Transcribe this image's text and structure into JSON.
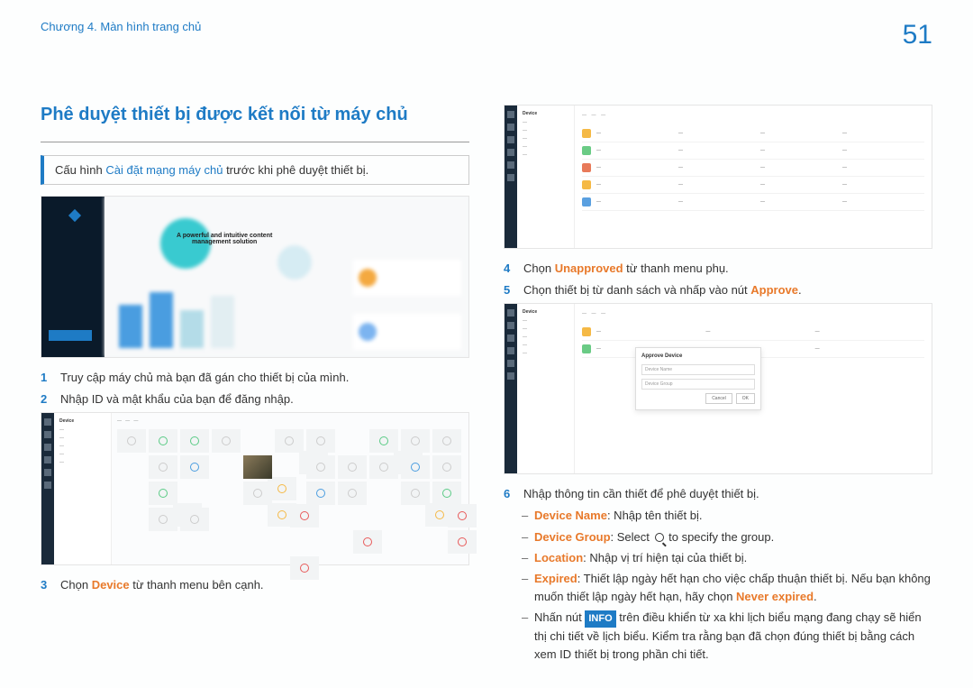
{
  "header": {
    "breadcrumb": "Chương 4. Màn hình trang chủ",
    "page_number": "51"
  },
  "section_title": "Phê duyệt thiết bị được kết nối từ máy chủ",
  "note": {
    "prefix": "Cấu hình ",
    "link": "Cài đặt mạng máy chủ",
    "suffix": " trước khi phê duyệt thiết bị."
  },
  "dash_text1": "A powerful and intuitive content",
  "dash_text2": "management solution",
  "grid_label": "Device",
  "list_label": "Device",
  "dialog_title": "Approve Device",
  "dialog_field1": "Device Name",
  "dialog_field2": "Device Group",
  "dialog_btn1": "Cancel",
  "dialog_btn2": "OK",
  "step1": "Truy cập máy chủ mà bạn đã gán cho thiết bị của mình.",
  "step2": "Nhập ID và mật khẩu của bạn để đăng nhập.",
  "step3_a": "Chọn ",
  "step3_b": "Device",
  "step3_c": " từ thanh menu bên cạnh.",
  "step4_a": "Chọn ",
  "step4_b": "Unapproved",
  "step4_c": " từ thanh menu phụ.",
  "step5_a": "Chọn thiết bị từ danh sách và nhấp vào nút ",
  "step5_b": "Approve",
  "step5_c": ".",
  "step6": "Nhập thông tin cần thiết để phê duyệt thiết bị.",
  "sub1_a": "Device Name",
  "sub1_b": ": Nhập tên thiết bị.",
  "sub2_a": "Device Group",
  "sub2_b": ": Select ",
  "sub2_c": " to specify the group.",
  "sub3_a": "Location",
  "sub3_b": ": Nhập vị trí hiện tại của thiết bị.",
  "sub4_a": "Expired",
  "sub4_b": ": Thiết lập ngày hết hạn cho việc chấp thuận thiết bị. Nếu bạn không muốn thiết lập ngày hết hạn, hãy chọn ",
  "sub4_c": "Never expired",
  "sub4_d": ".",
  "sub5_a": "Nhấn nút ",
  "sub5_info": "INFO",
  "sub5_b": " trên điều khiển từ xa khi lịch biểu mạng đang chạy sẽ hiển thị chi tiết về lịch biểu. Kiểm tra rằng bạn đã chọn đúng thiết bị bằng cách xem ID thiết bị trong phần chi tiết.",
  "num1": "1",
  "num2": "2",
  "num3": "3",
  "num4": "4",
  "num5": "5",
  "num6": "6"
}
